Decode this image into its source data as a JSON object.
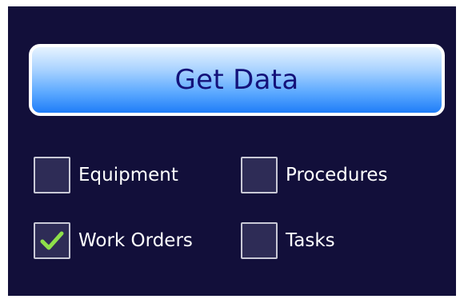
{
  "actions": {
    "get_data_label": "Get Data"
  },
  "options": [
    {
      "label": "Equipment",
      "checked": false
    },
    {
      "label": "Procedures",
      "checked": false
    },
    {
      "label": "Work Orders",
      "checked": true
    },
    {
      "label": "Tasks",
      "checked": false
    }
  ],
  "colors": {
    "background": "#120f3a",
    "button_text": "#14127a",
    "checkmark": "#8ee04a",
    "checkbox_fill": "#2e2c56"
  },
  "icons": {
    "checkmark": "check-icon"
  }
}
